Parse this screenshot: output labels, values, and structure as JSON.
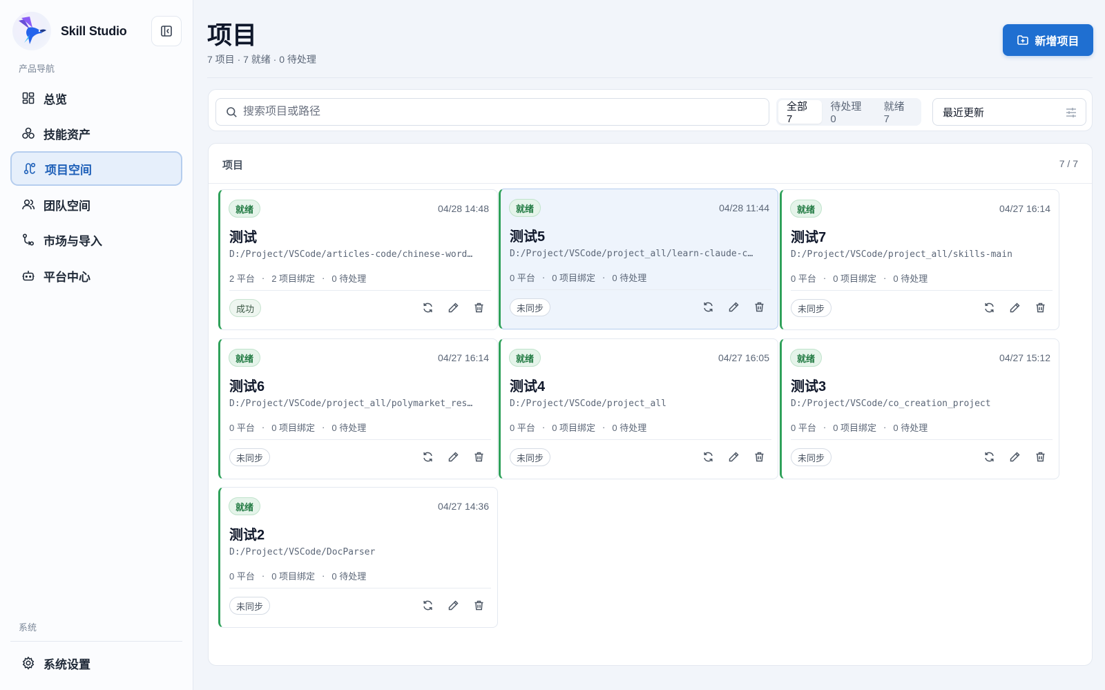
{
  "app": {
    "name": "Skill Studio"
  },
  "sidebar": {
    "section_label": "产品导航",
    "items": [
      {
        "label": "总览",
        "icon": "grid-icon"
      },
      {
        "label": "技能资产",
        "icon": "cubes-icon"
      },
      {
        "label": "项目空间",
        "icon": "route-icon",
        "active": true
      },
      {
        "label": "团队空间",
        "icon": "users-icon"
      },
      {
        "label": "市场与导入",
        "icon": "git-pull-icon"
      },
      {
        "label": "平台中心",
        "icon": "bot-icon"
      }
    ],
    "system_label": "系统",
    "settings_label": "系统设置"
  },
  "header": {
    "title": "项目",
    "subtitle": "7 项目 · 7 就绪 · 0 待处理",
    "new_button": "新增项目"
  },
  "toolbar": {
    "search_placeholder": "搜索项目或路径",
    "filters": [
      "全部 7",
      "待处理 0",
      "就绪 7"
    ],
    "sort_value": "最近更新"
  },
  "panel": {
    "title": "项目",
    "count": "7 / 7"
  },
  "projects": [
    {
      "status": "就绪",
      "time": "04/28 14:48",
      "name": "测试",
      "path": "D:/Project/VSCode/articles-code/chinese-word…",
      "platforms": "2 平台",
      "bindings": "2 项目绑定",
      "pending": "0 待处理",
      "sync": "成功"
    },
    {
      "status": "就绪",
      "time": "04/28 11:44",
      "name": "测试5",
      "path": "D:/Project/VSCode/project_all/learn-claude-c…",
      "platforms": "0 平台",
      "bindings": "0 项目绑定",
      "pending": "0 待处理",
      "sync": "未同步"
    },
    {
      "status": "就绪",
      "time": "04/27 16:14",
      "name": "测试7",
      "path": "D:/Project/VSCode/project_all/skills-main",
      "platforms": "0 平台",
      "bindings": "0 项目绑定",
      "pending": "0 待处理",
      "sync": "未同步"
    },
    {
      "status": "就绪",
      "time": "04/27 16:14",
      "name": "测试6",
      "path": "D:/Project/VSCode/project_all/polymarket_res…",
      "platforms": "0 平台",
      "bindings": "0 项目绑定",
      "pending": "0 待处理",
      "sync": "未同步"
    },
    {
      "status": "就绪",
      "time": "04/27 16:05",
      "name": "测试4",
      "path": "D:/Project/VSCode/project_all",
      "platforms": "0 平台",
      "bindings": "0 项目绑定",
      "pending": "0 待处理",
      "sync": "未同步"
    },
    {
      "status": "就绪",
      "time": "04/27 15:12",
      "name": "测试3",
      "path": "D:/Project/VSCode/co_creation_project",
      "platforms": "0 平台",
      "bindings": "0 项目绑定",
      "pending": "0 待处理",
      "sync": "未同步"
    },
    {
      "status": "就绪",
      "time": "04/27 14:36",
      "name": "测试2",
      "path": "D:/Project/VSCode/DocParser",
      "platforms": "0 平台",
      "bindings": "0 项目绑定",
      "pending": "0 待处理",
      "sync": "未同步"
    }
  ],
  "colors": {
    "accent": "#1f6fd1",
    "ready_green": "#2fa15a",
    "active_nav_bg": "#e6effb"
  }
}
